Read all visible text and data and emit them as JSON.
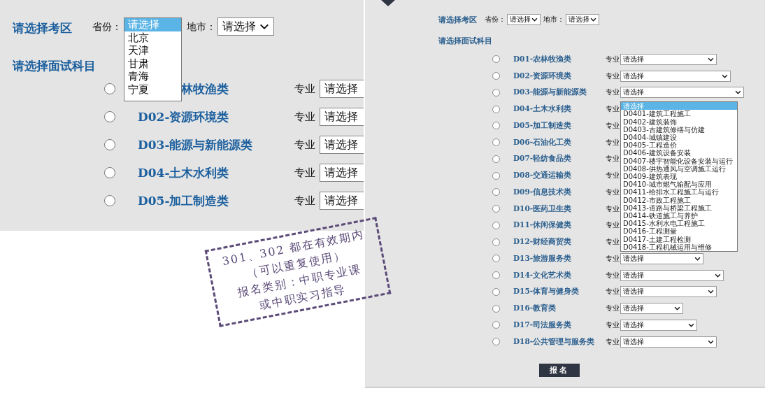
{
  "left_view": {
    "zone_title": "请选择考区",
    "province_label": "省份：",
    "province_select": {
      "expanded": true,
      "options": [
        {
          "label": "请选择",
          "selected": true
        },
        {
          "label": "北京",
          "selected": false
        },
        {
          "label": "天津",
          "selected": false
        },
        {
          "label": "甘肃",
          "selected": false
        },
        {
          "label": "青海",
          "selected": false
        },
        {
          "label": "宁夏",
          "selected": false
        }
      ]
    },
    "city_label": "地市：",
    "city_select": {
      "value": "请选择",
      "expanded": false
    },
    "subject_title": "请选择面试科目",
    "rows": [
      {
        "label": "林牧渔类",
        "selected": false,
        "major_label": "专业",
        "select_value": "请选择"
      },
      {
        "label": "D02-资源环境类",
        "selected": false,
        "major_label": "专业",
        "select_value": "请选择"
      },
      {
        "label": "D03-能源与新能源类",
        "selected": false,
        "major_label": "专业",
        "select_value": "请选择"
      },
      {
        "label": "D04-土木水利类",
        "selected": false,
        "major_label": "专业",
        "select_value": "请选择"
      },
      {
        "label": "D05-加工制造类",
        "selected": false,
        "major_label": "专业",
        "select_value": "请选择"
      }
    ]
  },
  "right_view": {
    "zone_title": "请选择考区",
    "province_label": "省份：",
    "province_select": {
      "value": "请选择",
      "expanded": false
    },
    "city_label": "地市：",
    "city_select": {
      "value": "请选择",
      "expanded": false
    },
    "subject_title": "请选择面试科目",
    "rows": [
      {
        "label": "D01-农林牧渔类",
        "selected": false,
        "major_label": "专业",
        "select": {
          "value": "请选择",
          "expanded": false
        }
      },
      {
        "label": "D02-资源环境类",
        "selected": false,
        "major_label": "专业",
        "select": {
          "value": "请选择",
          "expanded": false
        }
      },
      {
        "label": "D03-能源与新能源类",
        "selected": false,
        "major_label": "专业",
        "select": {
          "value": "请选择",
          "expanded": false
        }
      },
      {
        "label": "D04-土木水利类",
        "selected": false,
        "major_label": "专业",
        "select": {
          "expanded": true,
          "options": [
            {
              "label": "请选择",
              "selected": true
            },
            {
              "label": "D0401-建筑工程施工",
              "selected": false
            },
            {
              "label": "D0402-建筑装饰",
              "selected": false
            },
            {
              "label": "D0403-古建筑修缮与仿建",
              "selected": false
            },
            {
              "label": "D0404-城镇建设",
              "selected": false
            },
            {
              "label": "D0405-工程造价",
              "selected": false
            },
            {
              "label": "D0406-建筑设备安装",
              "selected": false
            },
            {
              "label": "D0407-楼宇智能化设备安装与运行",
              "selected": false
            },
            {
              "label": "D0408-供热通风与空调施工运行",
              "selected": false
            },
            {
              "label": "D0409-建筑表现",
              "selected": false
            },
            {
              "label": "D0410-城市燃气输配与应用",
              "selected": false
            },
            {
              "label": "D0411-给排水工程施工与运行",
              "selected": false
            },
            {
              "label": "D0412-市政工程施工",
              "selected": false
            },
            {
              "label": "D0413-道路与桥梁工程施工",
              "selected": false
            },
            {
              "label": "D0414-铁道施工与养护",
              "selected": false
            },
            {
              "label": "D0415-水利水电工程施工",
              "selected": false
            },
            {
              "label": "D0416-工程测量",
              "selected": false
            },
            {
              "label": "D0417-土建工程检测",
              "selected": false
            },
            {
              "label": "D0418-工程机械运用与维修",
              "selected": false
            }
          ]
        }
      },
      {
        "label": "D05-加工制造类",
        "selected": false,
        "major_label": "专业"
      },
      {
        "label": "D06-石油化工类",
        "selected": false,
        "major_label": "专业"
      },
      {
        "label": "D07-轻纺食品类",
        "selected": false,
        "major_label": "专业"
      },
      {
        "label": "D08-交通运输类",
        "selected": false,
        "major_label": "专业"
      },
      {
        "label": "D09-信息技术类",
        "selected": false,
        "major_label": "专业"
      },
      {
        "label": "D10-医药卫生类",
        "selected": false,
        "major_label": "专业"
      },
      {
        "label": "D11-休闲保健类",
        "selected": false,
        "major_label": "专业"
      },
      {
        "label": "D12-财经商贸类",
        "selected": false,
        "major_label": "专业"
      },
      {
        "label": "D13-旅游服务类",
        "selected": false,
        "major_label": "专业",
        "select": {
          "value": "请选择",
          "expanded": false
        }
      },
      {
        "label": "D14-文化艺术类",
        "selected": false,
        "major_label": "专业",
        "select": {
          "value": "请选择",
          "expanded": false
        }
      },
      {
        "label": "D15-体育与健身类",
        "selected": false,
        "major_label": "专业",
        "select": {
          "value": "请选择",
          "expanded": false
        }
      },
      {
        "label": "D16-教育类",
        "selected": false,
        "major_label": "专业",
        "select": {
          "value": "请选择",
          "expanded": false
        }
      },
      {
        "label": "D17-司法服务类",
        "selected": false,
        "major_label": "专业",
        "select": {
          "value": "请选择",
          "expanded": false
        }
      },
      {
        "label": "D18-公共管理与服务类",
        "selected": false,
        "major_label": "专业",
        "select": {
          "value": "请选择",
          "expanded": false
        }
      }
    ],
    "submit_button": "报名"
  },
  "note": {
    "lines": [
      "301、302 都在有效期内",
      "（可以重复使用）",
      "报名类别：中职专业课",
      "或中职实习指导"
    ]
  }
}
